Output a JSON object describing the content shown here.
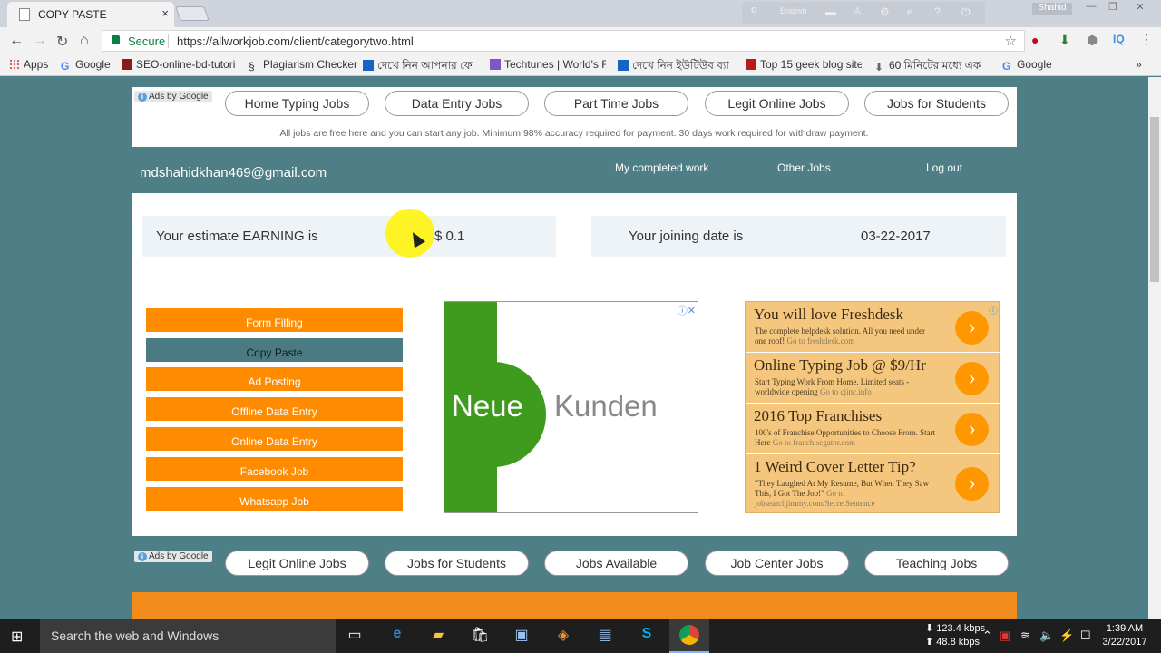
{
  "browser": {
    "tab_title": "COPY PASTE",
    "tab_close": "×",
    "language": "English",
    "user": "Shahid",
    "security_label": "Secure",
    "url": "https://allworkjob.com/client/categorytwo.html",
    "bookmarks": [
      {
        "label": "Apps",
        "icon": "apps-grid-icon"
      },
      {
        "label": "Google",
        "icon": "google-icon"
      },
      {
        "label": "SEO-online-bd-tutori",
        "icon": "seo-favicon-icon"
      },
      {
        "label": "Plagiarism Checker",
        "icon": "plagiarism-icon"
      },
      {
        "label": "দেখে নিন আপনার ফে",
        "icon": "favicon-icon"
      },
      {
        "label": "Techtunes | World's F",
        "icon": "techtunes-icon"
      },
      {
        "label": "দেখে নিন ইউটিউব ব্যা",
        "icon": "at-favicon-icon"
      },
      {
        "label": "Top 15 geek blog site",
        "icon": "w-favicon-icon"
      },
      {
        "label": "60 মিনিটের মধ্যে এক",
        "icon": "download-favicon-icon"
      },
      {
        "label": "Google",
        "icon": "google-icon"
      }
    ]
  },
  "top_ads": {
    "ads_by": "Ads by Google",
    "links": [
      "Home Typing Jobs",
      "Data Entry Jobs",
      "Part Time Jobs",
      "Legit Online Jobs",
      "Jobs for Students"
    ],
    "notice": "All jobs are free here and you can start any job. Minimum 98% accuracy required for payment. 30 days work required for withdraw payment."
  },
  "header": {
    "email": "mdshahidkhan469@gmail.com",
    "nav": [
      "My completed work",
      "Other Jobs",
      "Log out"
    ]
  },
  "earning": {
    "label": "Your estimate EARNING is",
    "value": "$ 0.1"
  },
  "joining": {
    "label": "Your joining date is",
    "value": "03-22-2017"
  },
  "menu": {
    "items": [
      "Form Filling",
      "Copy Paste",
      "Ad Posting",
      "Offline Data Entry",
      "Online Data Entry",
      "Facebook Job",
      "Whatsapp Job"
    ],
    "active_index": 1
  },
  "banner_ad": {
    "word1": "Neue",
    "word2": "Kunden"
  },
  "text_ads": [
    {
      "title": "You will love Freshdesk",
      "desc": "The complete helpdesk solution. All you need under one roof!",
      "url": "Go to freshdesk.com"
    },
    {
      "title": "Online Typing Job @ $9/Hr",
      "desc": "Start Typing Work From Home. Limited seats - worldwide opening",
      "url": "Go to cjinc.info"
    },
    {
      "title": "2016 Top Franchises",
      "desc": "100's of Franchise Opportunities to Choose From. Start Here",
      "url": "Go to franchisegator.com"
    },
    {
      "title": "1 Weird Cover Letter Tip?",
      "desc": "\"They Laughed At My Resume, But When They Saw This, I Got The Job!\"",
      "url": "Go to jobsearchjimmy.com/SecretSentence"
    }
  ],
  "bottom_ads": {
    "ads_by": "Ads by Google",
    "links": [
      "Legit Online Jobs",
      "Jobs for Students",
      "Jobs Available",
      "Job Center Jobs",
      "Teaching Jobs"
    ]
  },
  "taskbar": {
    "search_placeholder": "Search the web and Windows",
    "net_down": "123.4 kbps",
    "net_up": "48.8 kbps",
    "time": "1:39 AM",
    "date": "3/22/2017"
  }
}
